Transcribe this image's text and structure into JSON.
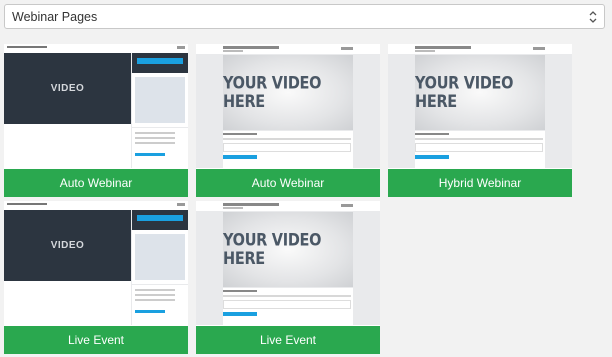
{
  "dropdown": {
    "value": "Webinar Pages"
  },
  "thumbnail_text": {
    "video_dark": "VIDEO",
    "video_light": "YOUR VIDEO HERE"
  },
  "cards": [
    {
      "label": "Auto Webinar",
      "style": "dark"
    },
    {
      "label": "Auto Webinar",
      "style": "standard"
    },
    {
      "label": "Hybrid Webinar",
      "style": "standard"
    },
    {
      "label": "Live Event",
      "style": "dark"
    },
    {
      "label": "Live Event",
      "style": "standard"
    }
  ],
  "colors": {
    "label_bg": "#2aa84f",
    "video_dark": "#2c3540",
    "accent_blue": "#1aa0e0"
  }
}
